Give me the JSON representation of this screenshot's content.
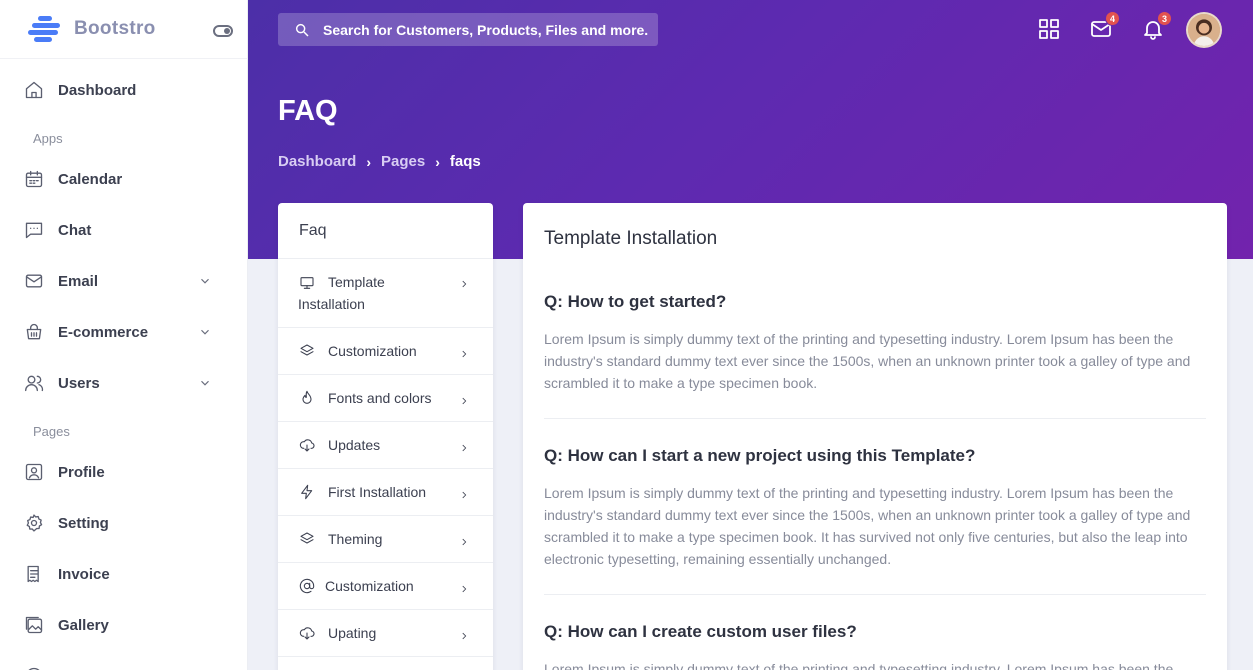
{
  "brand": {
    "name": "Bootstro",
    "accent": "#4a7cf7"
  },
  "sidebar": {
    "items": [
      {
        "label": "Dashboard",
        "icon": "home-icon"
      },
      {
        "label": "Calendar",
        "icon": "calendar-icon"
      },
      {
        "label": "Chat",
        "icon": "chat-icon"
      },
      {
        "label": "Email",
        "icon": "mail-icon",
        "expandable": true
      },
      {
        "label": "E-commerce",
        "icon": "basket-icon",
        "expandable": true
      },
      {
        "label": "Users",
        "icon": "users-icon",
        "expandable": true
      },
      {
        "label": "Profile",
        "icon": "profile-icon"
      },
      {
        "label": "Setting",
        "icon": "gear-icon"
      },
      {
        "label": "Invoice",
        "icon": "invoice-icon"
      },
      {
        "label": "Gallery",
        "icon": "gallery-icon"
      }
    ],
    "sections": {
      "apps": "Apps",
      "pages": "Pages"
    }
  },
  "header": {
    "search_placeholder": "Search for Customers, Products, Files and more.",
    "mail_badge": "4",
    "notification_badge": "3",
    "band_colors": [
      "#4c2fa8",
      "#7223ad"
    ]
  },
  "page": {
    "title": "FAQ",
    "breadcrumb": [
      "Dashboard",
      "Pages",
      "faqs"
    ]
  },
  "faq_nav": {
    "heading": "Faq",
    "items": [
      {
        "label": "Template Installation",
        "icon": "monitor-icon"
      },
      {
        "label": "Customization",
        "icon": "layers-icon"
      },
      {
        "label": "Fonts and colors",
        "icon": "flame-icon"
      },
      {
        "label": "Updates",
        "icon": "cloud-download-icon"
      },
      {
        "label": "First Installation",
        "icon": "lightning-icon"
      },
      {
        "label": "Theming",
        "icon": "layers-icon"
      },
      {
        "label": "Customization",
        "icon": "at-sign-icon"
      },
      {
        "label": "Upating",
        "icon": "cloud-download-icon"
      }
    ]
  },
  "content": {
    "title": "Template Installation",
    "faqs": [
      {
        "question": "Q: How to get started?",
        "answer": "Lorem Ipsum is simply dummy text of the printing and typesetting industry. Lorem Ipsum has been the industry's standard dummy text ever since the 1500s, when an unknown printer took a galley of type and scrambled it to make a type specimen book."
      },
      {
        "question": "Q: How can I start a new project using this Template?",
        "answer": "Lorem Ipsum is simply dummy text of the printing and typesetting industry. Lorem Ipsum has been the industry's standard dummy text ever since the 1500s, when an unknown printer took a galley of type and scrambled it to make a type specimen book. It has survived not only five centuries, but also the leap into electronic typesetting, remaining essentially unchanged."
      },
      {
        "question": "Q: How can I create custom user files?",
        "answer": "Lorem Ipsum is simply dummy text of the printing and typesetting industry. Lorem Ipsum has been the"
      }
    ]
  }
}
